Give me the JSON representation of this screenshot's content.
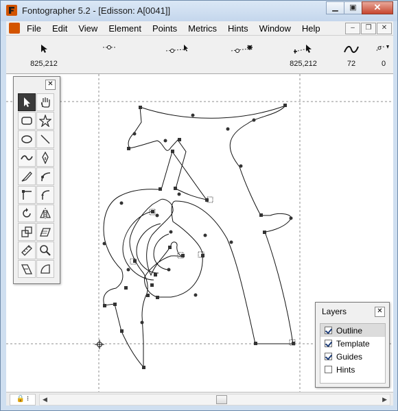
{
  "window": {
    "title": "Fontographer 5.2 - [Edisson: A[0041]]"
  },
  "menu": {
    "items": [
      "File",
      "Edit",
      "View",
      "Element",
      "Points",
      "Metrics",
      "Hints",
      "Window",
      "Help"
    ]
  },
  "toolbar": {
    "items": [
      {
        "icon": "pointer-coords-icon",
        "value": "825,212"
      },
      {
        "icon": "point-move-icon",
        "value": ""
      },
      {
        "icon": "point-drag-icon",
        "value": ""
      },
      {
        "icon": "point-add-icon",
        "value": ""
      },
      {
        "icon": "selection-move-icon",
        "value": "825,212"
      },
      {
        "icon": "curve-icon",
        "value": "72"
      },
      {
        "icon": "points-count-icon",
        "value": "0"
      }
    ]
  },
  "tools": [
    "pointer",
    "hand",
    "rectangle",
    "star",
    "ellipse",
    "line",
    "freehand",
    "pen",
    "calligraphic-pen",
    "curve-point",
    "corner-point",
    "tangent-point",
    "rotate",
    "reflect",
    "scale",
    "skew",
    "measure",
    "magnify",
    "knife",
    "quarter-circle"
  ],
  "layers": {
    "title": "Layers",
    "items": [
      {
        "label": "Outline",
        "checked": true,
        "selected": true
      },
      {
        "label": "Template",
        "checked": true,
        "selected": false
      },
      {
        "label": "Guides",
        "checked": true,
        "selected": false
      },
      {
        "label": "Hints",
        "checked": false,
        "selected": false
      }
    ]
  },
  "colors": {
    "titlebar": "#c4d6ec",
    "close": "#c7462f",
    "app_icon": "#d35400",
    "guide": "#8c8c8c"
  }
}
